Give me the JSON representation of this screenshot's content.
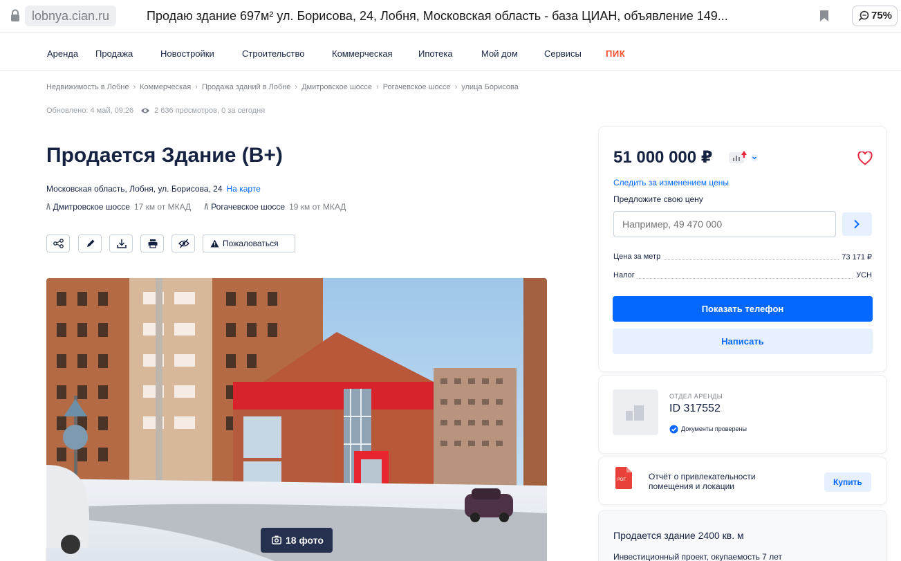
{
  "browser": {
    "domain": "lobnya.cian.ru",
    "tab_title": "Продаю здание 697м² ул. Борисова, 24, Лобня, Московская область - база ЦИАН, объявление 149...",
    "zoom": "75%"
  },
  "nav": {
    "items": [
      "Аренда",
      "Продажа",
      "Новостройки",
      "Строительство",
      "Коммерческая",
      "Ипотека",
      "Мой дом",
      "Сервисы"
    ],
    "brand": "ПИК",
    "brand_color": "#ff4d2e"
  },
  "breadcrumbs": [
    "Недвижимость в Лобне",
    "Коммерческая",
    "Продажа зданий в Лобне",
    "Дмитровское шоссе",
    "Рогачевское шоссе",
    "улица Борисова"
  ],
  "meta": {
    "updated": "Обновлено: 4 май, 09:26",
    "views": "2 636 просмотров, 0 за сегодня"
  },
  "listing": {
    "title": "Продается Здание (B+)",
    "address": "Московская область, Лобня, ул. Борисова, 24",
    "map_link": "На карте",
    "highways": [
      {
        "name": "Дмитровское шоссе",
        "distance": "17 км от МКАД"
      },
      {
        "name": "Рогачевское шоссе",
        "distance": "19 км от МКАД"
      }
    ],
    "report_label": "Пожаловаться",
    "photo_count": "18 фото"
  },
  "price_card": {
    "price": "51 000 000 ₽",
    "watch_link": "Следить за изменением цены",
    "offer_label": "Предложите свою цену",
    "offer_placeholder": "Например, 49 470 000",
    "specs": [
      {
        "label": "Цена за метр",
        "value": "73 171 ₽"
      },
      {
        "label": "Налог",
        "value": "УСН"
      }
    ],
    "show_phone": "Показать телефон",
    "write": "Написать"
  },
  "agent": {
    "department": "ОТДЕЛ АРЕНДЫ",
    "id": "ID 317552",
    "verified": "Документы проверены"
  },
  "report": {
    "text_line1": "Отчёт о привлекательности",
    "text_line2": "помещения и локации",
    "buy": "Купить"
  },
  "promo": {
    "title": "Продается здание 2400 кв. м",
    "subtitle": "Инвестиционный проект, окупаемость 7 лет"
  },
  "colors": {
    "accent": "#0468ff",
    "accent_light": "#e6f0ff",
    "text": "#152242",
    "favorite": "#e8243d"
  }
}
